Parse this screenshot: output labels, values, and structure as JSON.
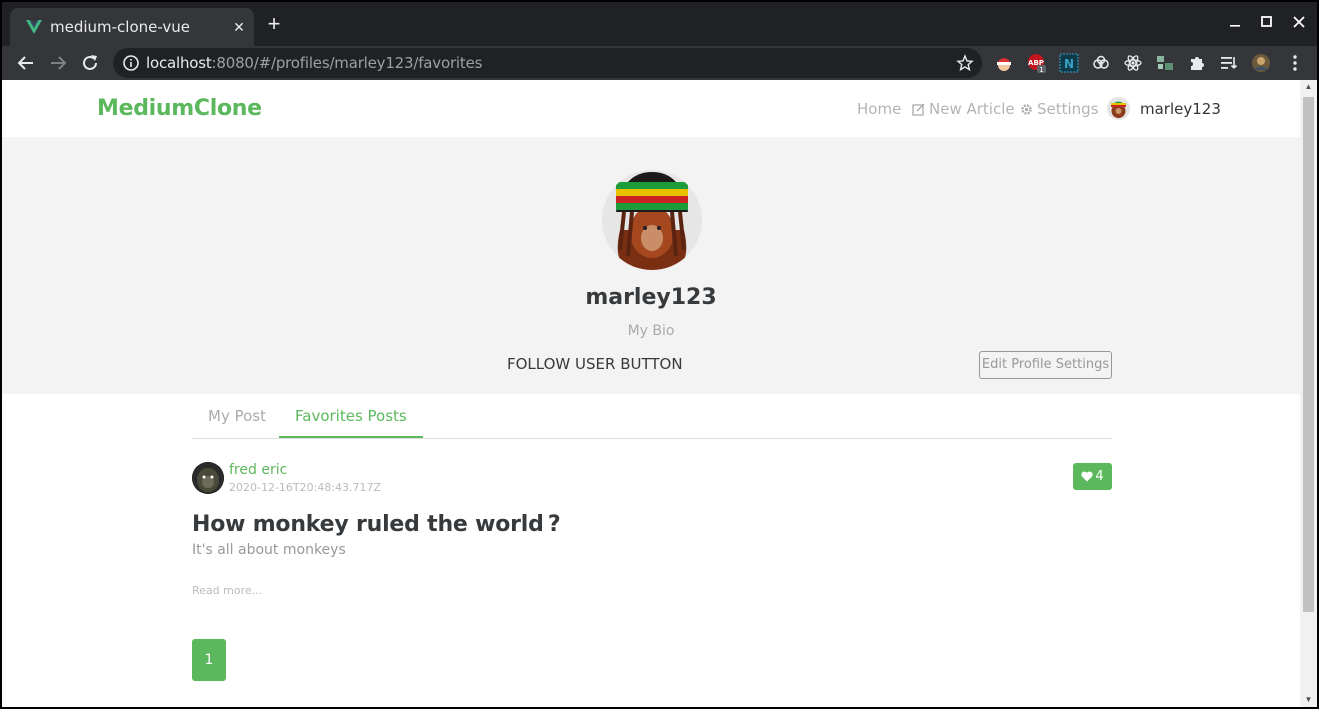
{
  "browser": {
    "tab_title": "medium-clone-vue",
    "tab_close": "✕",
    "new_tab": "+",
    "url_host": "localhost",
    "url_rest": ":8080/#/profiles/marley123/favorites",
    "extension_badge_count": "1"
  },
  "nav": {
    "brand": "MediumClone",
    "home": "Home",
    "new_article": "New Article",
    "settings": "Settings",
    "username": "marley123"
  },
  "profile": {
    "username": "marley123",
    "bio": "My Bio",
    "follow_text": "FOLLOW USER BUTTON",
    "edit_button": "Edit Profile Settings"
  },
  "feed_tabs": [
    {
      "label": "My Post",
      "active": false
    },
    {
      "label": "Favorites Posts",
      "active": true
    }
  ],
  "articles": [
    {
      "author": "fred eric",
      "date": "2020-12-16T20:48:43.717Z",
      "favorites_count": "4",
      "title": "How monkey ruled the world ?",
      "description": "It's all about monkeys",
      "read_more": "Read more..."
    }
  ],
  "pagination": {
    "pages": [
      "1"
    ],
    "current": "1"
  },
  "colors": {
    "accent": "#5cb85c",
    "banner_bg": "#f3f3f3",
    "chrome_dark": "#202124",
    "chrome_toolbar": "#35363a"
  },
  "icons": [
    "vue-logo-icon",
    "close-icon",
    "plus-icon",
    "back-arrow-icon",
    "forward-arrow-icon",
    "reload-icon",
    "info-icon",
    "star-icon",
    "edit-icon",
    "gear-icon",
    "heart-icon",
    "puzzle-icon",
    "kebab-menu-icon"
  ]
}
